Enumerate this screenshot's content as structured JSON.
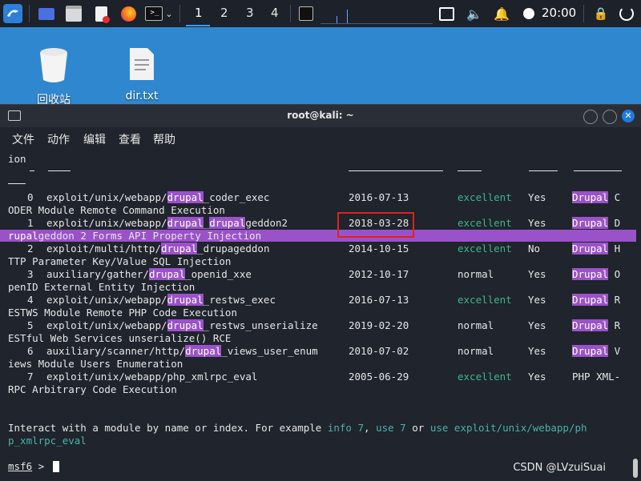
{
  "taskbar": {
    "workspaces": [
      "1",
      "2",
      "3",
      "4"
    ],
    "clock": "20:00"
  },
  "desktop": {
    "icons": [
      {
        "label": "回收站",
        "icon": "trash-icon"
      },
      {
        "label": "dir.txt",
        "icon": "text-file-icon"
      }
    ]
  },
  "window": {
    "title": "root@kali: ~",
    "menu": [
      "文件",
      "动作",
      "编辑",
      "查看",
      "帮助"
    ]
  },
  "terminal": {
    "header_fragment": "ion",
    "rows": [
      {
        "idx": "0",
        "path_pre": "exploit/unix/webapp/",
        "path_hl": "drupal",
        "path_mid": "_coder_exec",
        "path_hl2": "",
        "path_post": "",
        "date": "2016-07-13",
        "rank": "excellent",
        "check": "Yes",
        "desc_hl": "Drupal",
        "desc_tail": " C",
        "cont_hl": "",
        "cont": "ODER Module Remote Command Execution"
      },
      {
        "idx": "1",
        "path_pre": "exploit/unix/webapp/",
        "path_hl": "drupal",
        "path_mid": "_",
        "path_hl2": "drupal",
        "path_post": "geddon2",
        "date": "2018-03-28",
        "rank": "excellent",
        "check": "Yes",
        "desc_hl": "Drupal",
        "desc_tail": " D",
        "cont_hl": "rupal",
        "cont": "geddon 2 Forms API Property Injection"
      },
      {
        "idx": "2",
        "path_pre": "exploit/multi/http/",
        "path_hl": "drupal",
        "path_mid": "_drupageddon",
        "path_hl2": "",
        "path_post": "",
        "date": "2014-10-15",
        "rank": "excellent",
        "check": "No",
        "desc_hl": "Drupal",
        "desc_tail": " H",
        "cont_hl": "",
        "cont": "TTP Parameter Key/Value SQL Injection"
      },
      {
        "idx": "3",
        "path_pre": "auxiliary/gather/",
        "path_hl": "drupal",
        "path_mid": "_openid_xxe",
        "path_hl2": "",
        "path_post": "",
        "date": "2012-10-17",
        "rank": "normal",
        "check": "Yes",
        "desc_hl": "Drupal",
        "desc_tail": " O",
        "cont_hl": "",
        "cont": "penID External Entity Injection"
      },
      {
        "idx": "4",
        "path_pre": "exploit/unix/webapp/",
        "path_hl": "drupal",
        "path_mid": "_restws_exec",
        "path_hl2": "",
        "path_post": "",
        "date": "2016-07-13",
        "rank": "excellent",
        "check": "Yes",
        "desc_hl": "Drupal",
        "desc_tail": " R",
        "cont_hl": "",
        "cont": "ESTWS Module Remote PHP Code Execution"
      },
      {
        "idx": "5",
        "path_pre": "exploit/unix/webapp/",
        "path_hl": "drupal",
        "path_mid": "_restws_unserialize",
        "path_hl2": "",
        "path_post": "",
        "date": "2019-02-20",
        "rank": "normal",
        "check": "Yes",
        "desc_hl": "Drupal",
        "desc_tail": " R",
        "cont_hl": "",
        "cont": "ESTful Web Services unserialize() RCE"
      },
      {
        "idx": "6",
        "path_pre": "auxiliary/scanner/http/",
        "path_hl": "drupal",
        "path_mid": "_views_user_enum",
        "path_hl2": "",
        "path_post": "",
        "date": "2010-07-02",
        "rank": "normal",
        "check": "Yes",
        "desc_hl": "Drupal",
        "desc_tail": " V",
        "cont_hl": "",
        "cont": "iews Module Users Enumeration"
      },
      {
        "idx": "7",
        "path_pre": "exploit/unix/webapp/php_xmlrpc_eval",
        "path_hl": "",
        "path_mid": "",
        "path_hl2": "",
        "path_post": "",
        "date": "2005-06-29",
        "rank": "excellent",
        "check": "Yes",
        "desc_hl": "",
        "desc_tail": "PHP XML-",
        "cont_hl": "",
        "cont": "RPC Arbitrary Code Execution"
      }
    ],
    "interact_prefix": "Interact with a module by name or index. For example ",
    "interact_info": "info 7",
    "interact_comma": ", ",
    "interact_use": "use 7",
    "interact_or": " or ",
    "interact_use_path": "use exploit/unix/webapp/ph",
    "interact_use_path_cont": "p_xmlrpc_eval",
    "prompt": "msf6",
    "prompt_symbol": " >"
  },
  "watermark": "CSDN @LVzuiSuai",
  "colors": {
    "highlight": "#9a52c9",
    "excellent": "#3fb58a",
    "link": "#4ab3a8",
    "annotation_box": "#e0221f"
  }
}
